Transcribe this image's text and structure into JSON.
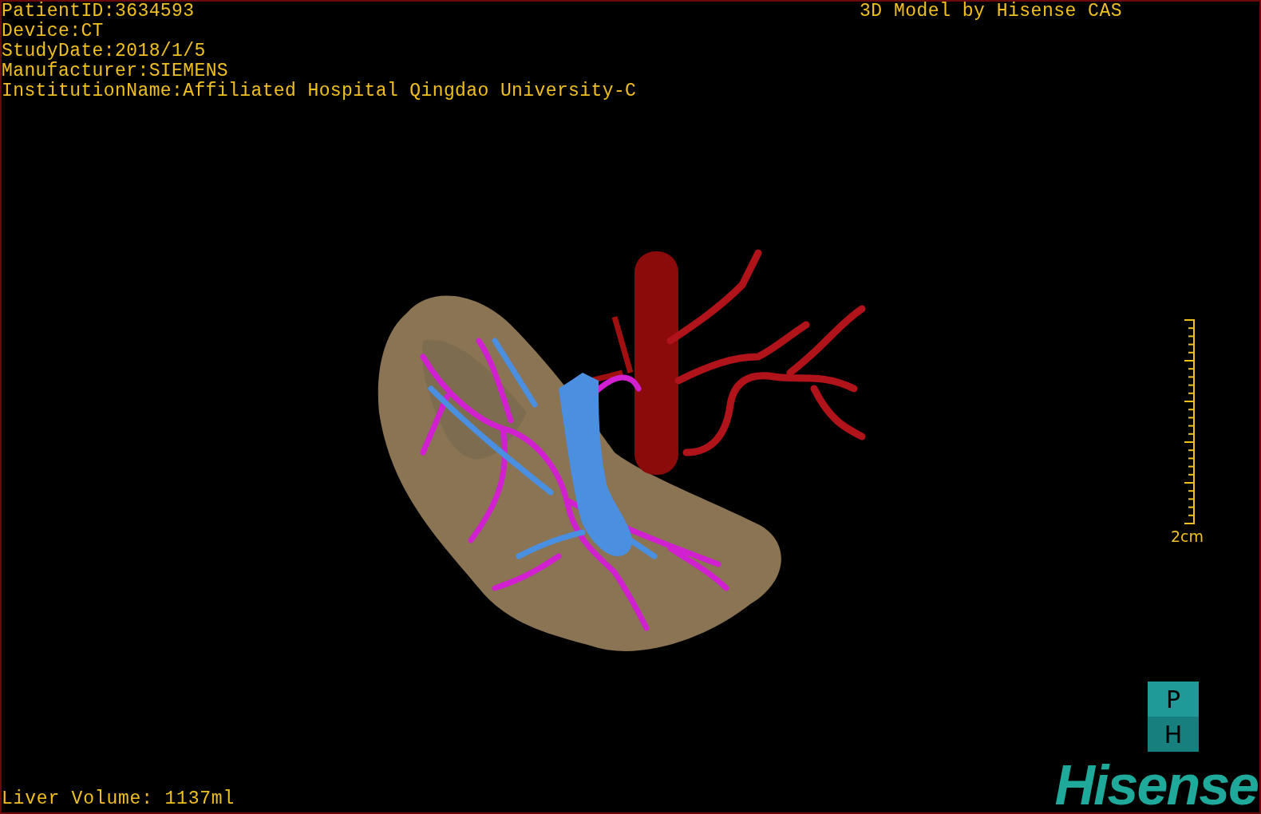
{
  "study_info": [
    "PatientID:3634593",
    "Device:CT",
    "StudyDate:2018/1/5",
    "Manufacturer:SIEMENS",
    "InstitutionName:Affiliated Hospital Qingdao University-C"
  ],
  "model_title": "3D Model by Hisense CAS",
  "scale_bar": {
    "label": "2cm"
  },
  "liver_volume": "Liver Volume: 1137ml",
  "orientation_cube": {
    "top": "P",
    "bottom": "H"
  },
  "logo": "Hisense"
}
